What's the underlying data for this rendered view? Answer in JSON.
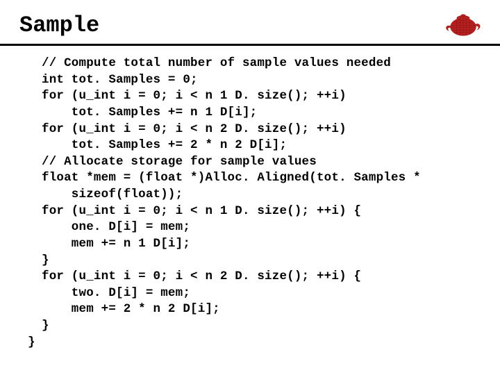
{
  "title": "Sample",
  "code": "// Compute total number of sample values needed\nint tot. Samples = 0;\nfor (u_int i = 0; i < n 1 D. size(); ++i)\n    tot. Samples += n 1 D[i];\nfor (u_int i = 0; i < n 2 D. size(); ++i)\n    tot. Samples += 2 * n 2 D[i];\n// Allocate storage for sample values\nfloat *mem = (float *)Alloc. Aligned(tot. Samples *\n    sizeof(float));\nfor (u_int i = 0; i < n 1 D. size(); ++i) {\n    one. D[i] = mem;\n    mem += n 1 D[i];\n}\nfor (u_int i = 0; i < n 2 D. size(); ++i) {\n    two. D[i] = mem;\n    mem += 2 * n 2 D[i];\n}",
  "closing_brace": "}"
}
